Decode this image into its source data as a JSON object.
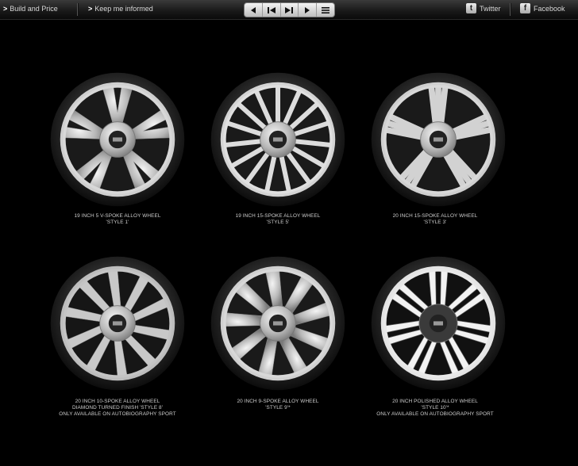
{
  "toolbar": {
    "build_label": "Build and Price",
    "keep_label": "Keep me informed",
    "twitter_label": "Twitter",
    "facebook_label": "Facebook"
  },
  "wheels": [
    {
      "line1": "19 INCH 5 V-SPOKE ALLOY WHEEL",
      "line2": "'STYLE 1'",
      "line3": ""
    },
    {
      "line1": "19 INCH 15-SPOKE ALLOY WHEEL",
      "line2": "'STYLE 5'",
      "line3": ""
    },
    {
      "line1": "20 INCH 15-SPOKE ALLOY WHEEL",
      "line2": "'STYLE 3'",
      "line3": ""
    },
    {
      "line1": "20 INCH 10-SPOKE ALLOY WHEEL",
      "line2": "DIAMOND TURNED FINISH 'STYLE 8'",
      "line3": "ONLY AVAILABLE ON AUTOBIOGRAPHY SPORT"
    },
    {
      "line1": "20 INCH 9-SPOKE ALLOY WHEEL",
      "line2": "'STYLE 9'*",
      "line3": ""
    },
    {
      "line1": "20 INCH POLISHED ALLOY WHEEL",
      "line2": "'STYLE 10'*",
      "line3": "ONLY AVAILABLE ON AUTOBIOGRAPHY SPORT"
    }
  ],
  "icons": {
    "prev": "prev-arrow-icon",
    "first": "skip-back-icon",
    "last": "skip-forward-icon",
    "next": "next-arrow-icon",
    "menu": "menu-icon",
    "twitter": "twitter-icon",
    "facebook": "facebook-icon"
  }
}
